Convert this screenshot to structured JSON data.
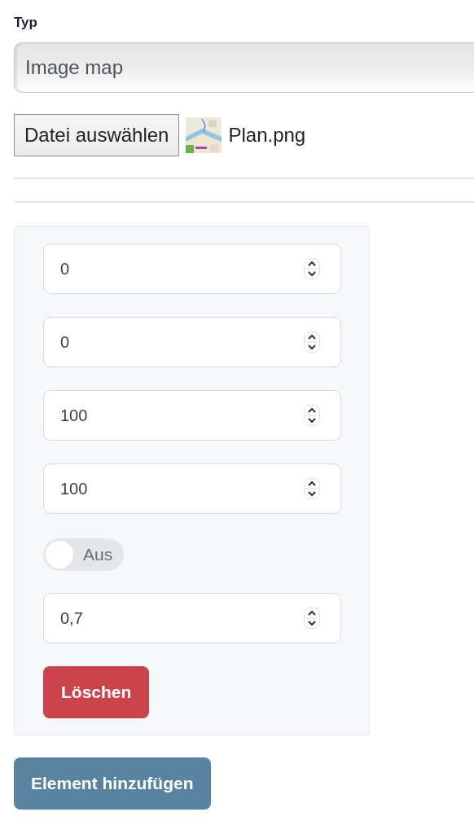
{
  "type_field": {
    "label": "Typ",
    "value": "Image map"
  },
  "file_picker": {
    "button": "Datei auswählen",
    "file_name": "Plan.png"
  },
  "element_card": {
    "fields": [
      {
        "kind": "number",
        "value": "0"
      },
      {
        "kind": "number",
        "value": "0"
      },
      {
        "kind": "number",
        "value": "100"
      },
      {
        "kind": "number",
        "value": "100"
      },
      {
        "kind": "toggle",
        "on": false,
        "label": "Aus"
      },
      {
        "kind": "number",
        "value": "0,7"
      }
    ],
    "delete_button": "Löschen"
  },
  "add_button": "Element hinzufügen"
}
